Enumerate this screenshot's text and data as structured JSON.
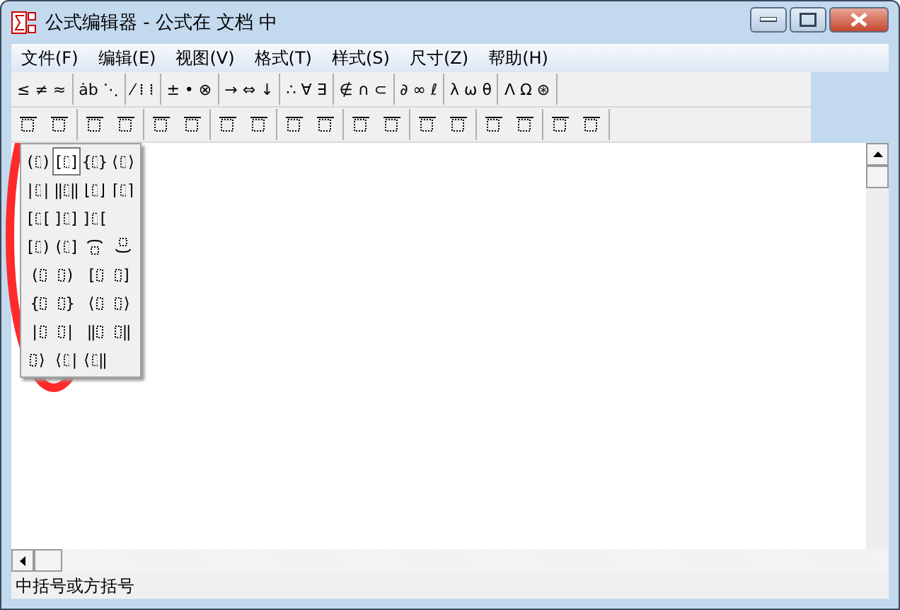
{
  "window": {
    "title": "公式编辑器 - 公式在 文档 中"
  },
  "menu": [
    "文件(F)",
    "编辑(E)",
    "视图(V)",
    "格式(T)",
    "样式(S)",
    "尺寸(Z)",
    "帮助(H)"
  ],
  "toolbar_row1": [
    "≤ ≠ ≈",
    "ȧb ⋱",
    "⁄ ⁞ ⁞",
    "± • ⊗",
    "→ ⇔ ↓",
    "∴ ∀ ∃",
    "∉ ∩ ⊂",
    "∂ ∞ ℓ",
    "λ ω θ",
    "Λ Ω ⊛"
  ],
  "bracket_palette": {
    "rows": [
      [
        {
          "kind": "pair",
          "left": "(",
          "right": ")",
          "selected": false
        },
        {
          "kind": "pair",
          "left": "[",
          "right": "]",
          "selected": true
        },
        {
          "kind": "pair",
          "left": "{",
          "right": "}",
          "selected": false
        },
        {
          "kind": "pair",
          "left": "⟨",
          "right": "⟩",
          "selected": false
        }
      ],
      [
        {
          "kind": "pair",
          "left": "|",
          "right": "|",
          "selected": false
        },
        {
          "kind": "pair",
          "left": "‖",
          "right": "‖",
          "selected": false
        },
        {
          "kind": "pair",
          "left": "⌊",
          "right": "⌋",
          "selected": false
        },
        {
          "kind": "pair",
          "left": "⌈",
          "right": "⌉",
          "selected": false
        }
      ],
      [
        {
          "kind": "pair",
          "left": "[",
          "right": "[",
          "selected": false
        },
        {
          "kind": "pair",
          "left": "]",
          "right": "]",
          "selected": false
        },
        {
          "kind": "pair",
          "left": "]",
          "right": "[",
          "selected": false
        }
      ],
      [
        {
          "kind": "pair",
          "left": "[",
          "right": ")",
          "selected": false
        },
        {
          "kind": "pair",
          "left": "(",
          "right": "]",
          "selected": false
        },
        {
          "kind": "overbrace",
          "selected": false
        },
        {
          "kind": "underbrace",
          "selected": false
        }
      ],
      [
        {
          "kind": "pair",
          "left": "(",
          "selected": false
        },
        {
          "kind": "pair",
          "right": ")",
          "selected": false
        },
        {
          "kind": "pair",
          "left": "[",
          "selected": false
        },
        {
          "kind": "pair",
          "right": "]",
          "selected": false
        }
      ],
      [
        {
          "kind": "pair",
          "left": "{",
          "selected": false
        },
        {
          "kind": "pair",
          "right": "}",
          "selected": false
        },
        {
          "kind": "pair",
          "left": "⟨",
          "selected": false
        },
        {
          "kind": "pair",
          "right": "⟩",
          "selected": false
        }
      ],
      [
        {
          "kind": "pair",
          "left": "|",
          "selected": false
        },
        {
          "kind": "pair",
          "right": "|",
          "selected": false
        },
        {
          "kind": "pair",
          "left": "‖",
          "selected": false
        },
        {
          "kind": "pair",
          "right": "‖",
          "selected": false
        }
      ],
      [
        {
          "kind": "pair",
          "right": "⟩",
          "selected": false
        },
        {
          "kind": "pair",
          "left": "⟨",
          "right": "|",
          "selected": false
        },
        {
          "kind": "pair",
          "left": "⟨",
          "right": "‖",
          "selected": false
        }
      ]
    ]
  },
  "status_bar": "中括号或方括号"
}
